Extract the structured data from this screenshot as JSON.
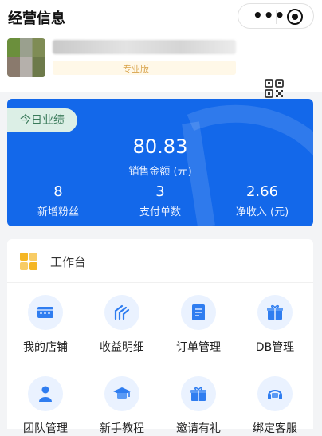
{
  "header": {
    "title": "经营信息"
  },
  "capsule": {
    "more_glyph": "•••"
  },
  "profile": {
    "edition_badge": "专业版"
  },
  "performance": {
    "tag": "今日业绩",
    "sales_amount": "80.83",
    "sales_label": "销售金额 (元)",
    "stats": [
      {
        "value": "8",
        "label": "新增粉丝"
      },
      {
        "value": "3",
        "label": "支付单数"
      },
      {
        "value": "2.66",
        "label": "净收入 (元)"
      }
    ],
    "accent_color": "#1368ea"
  },
  "workbench": {
    "title": "工作台",
    "tools": [
      {
        "label": "我的店铺",
        "icon": "store-icon"
      },
      {
        "label": "收益明细",
        "icon": "earnings-icon"
      },
      {
        "label": "订单管理",
        "icon": "order-icon"
      },
      {
        "label": "DB管理",
        "icon": "gift-box-icon"
      },
      {
        "label": "团队管理",
        "icon": "person-icon"
      },
      {
        "label": "新手教程",
        "icon": "graduation-cap-icon"
      },
      {
        "label": "邀请有礼",
        "icon": "gift-icon"
      },
      {
        "label": "绑定客服",
        "icon": "customer-service-icon"
      }
    ]
  }
}
